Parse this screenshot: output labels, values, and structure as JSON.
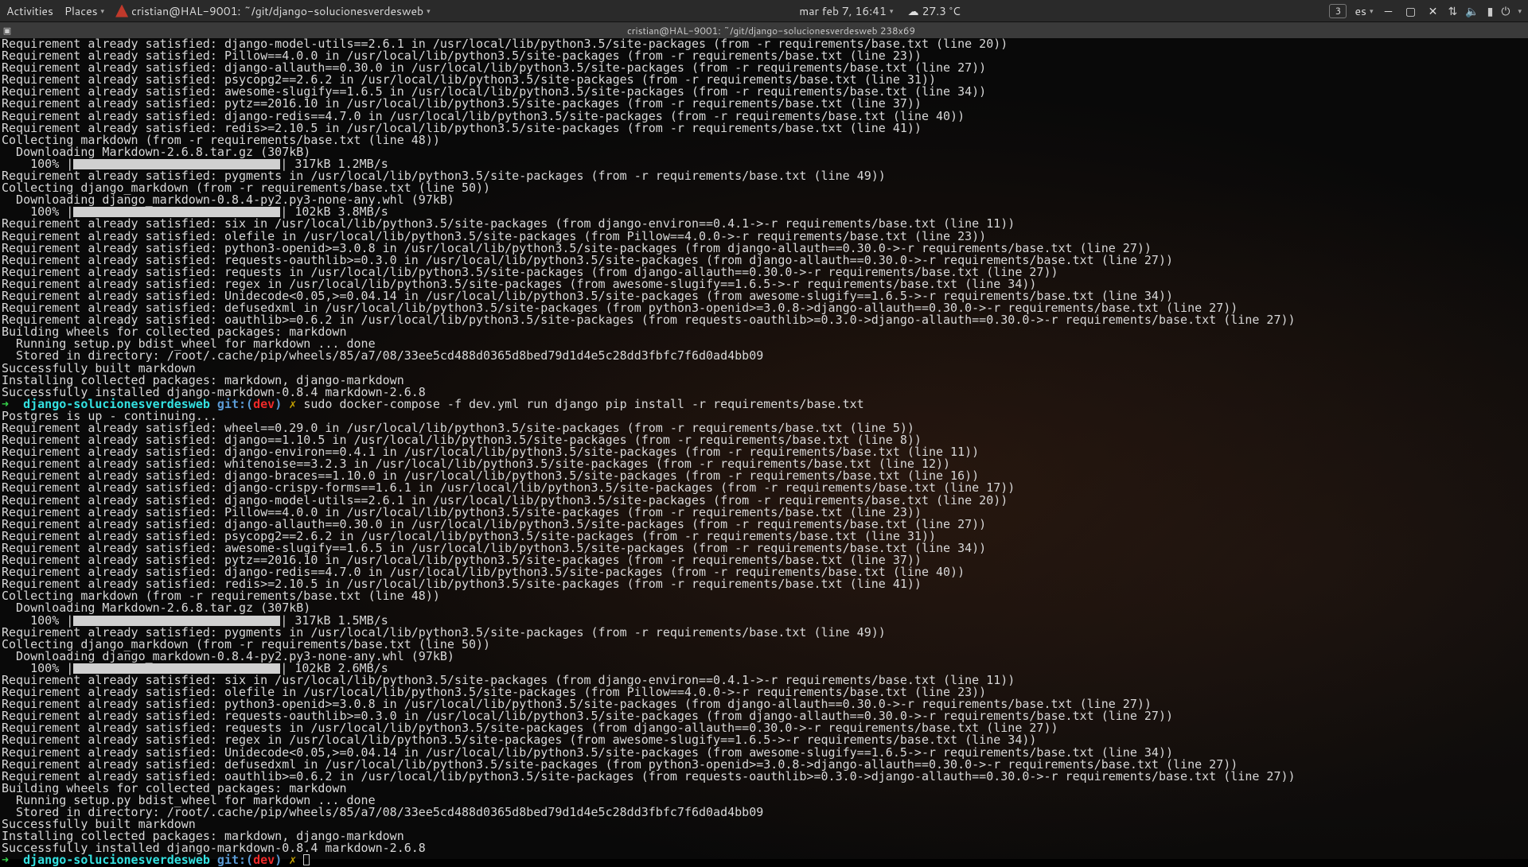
{
  "topbar": {
    "activities": "Activities",
    "places": "Places",
    "app_title": "cristian@HAL-9001: ~/git/django-solucionesverdesweb",
    "datetime": "mar feb  7, 16:41",
    "temp": "27.3 °C",
    "workspace": "3",
    "keyboard": "es"
  },
  "window": {
    "title": "cristian@HAL-9001: ~/git/django-solucionesverdesweb 238x69"
  },
  "req_prefix": "Requirement already satisfied: ",
  "req_path": " in /usr/local/lib/python3.5/site-packages (from -r requirements/base.txt ",
  "reqs_a": [
    [
      "django-model-utils==2.6.1",
      "(line 20))"
    ],
    [
      "Pillow==4.0.0",
      "(line 23))"
    ],
    [
      "django-allauth==0.30.0",
      "(line 27))"
    ],
    [
      "psycopg2==2.6.2",
      "(line 31))"
    ],
    [
      "awesome-slugify==1.6.5",
      "(line 34))"
    ],
    [
      "pytz==2016.10",
      "(line 37))"
    ],
    [
      "django-redis==4.7.0",
      "(line 40))"
    ],
    [
      "redis>=2.10.5",
      "(line 41))"
    ]
  ],
  "collect1": "Collecting markdown (from -r requirements/base.txt (line 48))",
  "dl1": "  Downloading Markdown-2.6.8.tar.gz (307kB)",
  "bar1": "    100% |",
  "bar1_tail": "| 317kB 1.2MB/s ",
  "req_pygments": "Requirement already satisfied: pygments in /usr/local/lib/python3.5/site-packages (from -r requirements/base.txt (line 49))",
  "collect2": "Collecting django_markdown (from -r requirements/base.txt (line 50))",
  "dl2": "  Downloading django_markdown-0.8.4-py2.py3-none-any.whl (97kB)",
  "bar2_tail": "| 102kB 3.8MB/s ",
  "indirect_a": [
    "Requirement already satisfied: six in /usr/local/lib/python3.5/site-packages (from django-environ==0.4.1->-r requirements/base.txt (line 11))",
    "Requirement already satisfied: olefile in /usr/local/lib/python3.5/site-packages (from Pillow==4.0.0->-r requirements/base.txt (line 23))",
    "Requirement already satisfied: python3-openid>=3.0.8 in /usr/local/lib/python3.5/site-packages (from django-allauth==0.30.0->-r requirements/base.txt (line 27))",
    "Requirement already satisfied: requests-oauthlib>=0.3.0 in /usr/local/lib/python3.5/site-packages (from django-allauth==0.30.0->-r requirements/base.txt (line 27))",
    "Requirement already satisfied: requests in /usr/local/lib/python3.5/site-packages (from django-allauth==0.30.0->-r requirements/base.txt (line 27))",
    "Requirement already satisfied: regex in /usr/local/lib/python3.5/site-packages (from awesome-slugify==1.6.5->-r requirements/base.txt (line 34))",
    "Requirement already satisfied: Unidecode<0.05,>=0.04.14 in /usr/local/lib/python3.5/site-packages (from awesome-slugify==1.6.5->-r requirements/base.txt (line 34))",
    "Requirement already satisfied: defusedxml in /usr/local/lib/python3.5/site-packages (from python3-openid>=3.0.8->django-allauth==0.30.0->-r requirements/base.txt (line 27))",
    "Requirement already satisfied: oauthlib>=0.6.2 in /usr/local/lib/python3.5/site-packages (from requests-oauthlib>=0.3.0->django-allauth==0.30.0->-r requirements/base.txt (line 27))"
  ],
  "build_lines": [
    "Building wheels for collected packages: markdown",
    "  Running setup.py bdist_wheel for markdown ... done",
    "  Stored in directory: /root/.cache/pip/wheels/85/a7/08/33ee5cd488d0365d8bed79d1d4e5c28dd3fbfc7f6d0ad4bb09",
    "Successfully built markdown",
    "Installing collected packages: markdown, django-markdown",
    "Successfully installed django-markdown-0.8.4 markdown-2.6.8"
  ],
  "prompt": {
    "arrow": "➜  ",
    "proj": "django-solucionesverdesweb",
    "git_l": " git:(",
    "branch": "dev",
    "git_r": ")",
    "dirty": " ✗ ",
    "cmd": "sudo docker-compose -f dev.yml run django pip install -r requirements/base.txt"
  },
  "postgres": "Postgres is up - continuing...",
  "reqs_b": [
    [
      "wheel==0.29.0",
      "(line 5))"
    ],
    [
      "django==1.10.5",
      "(line 8))"
    ],
    [
      "django-environ==0.4.1",
      "(line 11))"
    ],
    [
      "whitenoise==3.2.3",
      "(line 12))"
    ],
    [
      "django-braces==1.10.0",
      "(line 16))"
    ],
    [
      "django-crispy-forms==1.6.1",
      "(line 17))"
    ],
    [
      "django-model-utils==2.6.1",
      "(line 20))"
    ],
    [
      "Pillow==4.0.0",
      "(line 23))"
    ],
    [
      "django-allauth==0.30.0",
      "(line 27))"
    ],
    [
      "psycopg2==2.6.2",
      "(line 31))"
    ],
    [
      "awesome-slugify==1.6.5",
      "(line 34))"
    ],
    [
      "pytz==2016.10",
      "(line 37))"
    ],
    [
      "django-redis==4.7.0",
      "(line 40))"
    ],
    [
      "redis>=2.10.5",
      "(line 41))"
    ]
  ],
  "bar3_tail": "| 317kB 1.5MB/s ",
  "bar4_tail": "| 102kB 2.6MB/s "
}
